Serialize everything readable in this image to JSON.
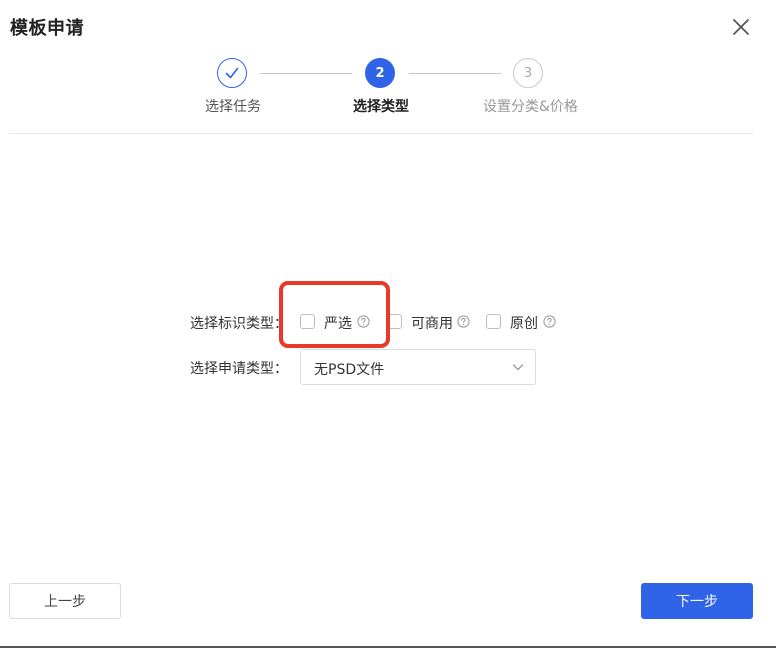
{
  "dialog": {
    "title": "模板申请"
  },
  "steps": [
    {
      "number": "1",
      "label": "选择任务",
      "status": "done"
    },
    {
      "number": "2",
      "label": "选择类型",
      "status": "active"
    },
    {
      "number": "3",
      "label": "设置分类&价格",
      "status": "pending"
    }
  ],
  "form": {
    "mark_type_label": "选择标识类型：",
    "mark_options": [
      {
        "label": "严选",
        "checked": false,
        "help_icon": "question-circle-icon"
      },
      {
        "label": "可商用",
        "checked": false,
        "help_icon": "question-circle-icon"
      },
      {
        "label": "原创",
        "checked": false,
        "help_icon": "question-circle-icon"
      }
    ],
    "apply_type_label": "选择申请类型：",
    "apply_type_value": "无PSD文件"
  },
  "footer": {
    "prev_label": "上一步",
    "next_label": "下一步"
  },
  "colors": {
    "primary": "#2f63e8",
    "highlight": "#e63a2a"
  }
}
